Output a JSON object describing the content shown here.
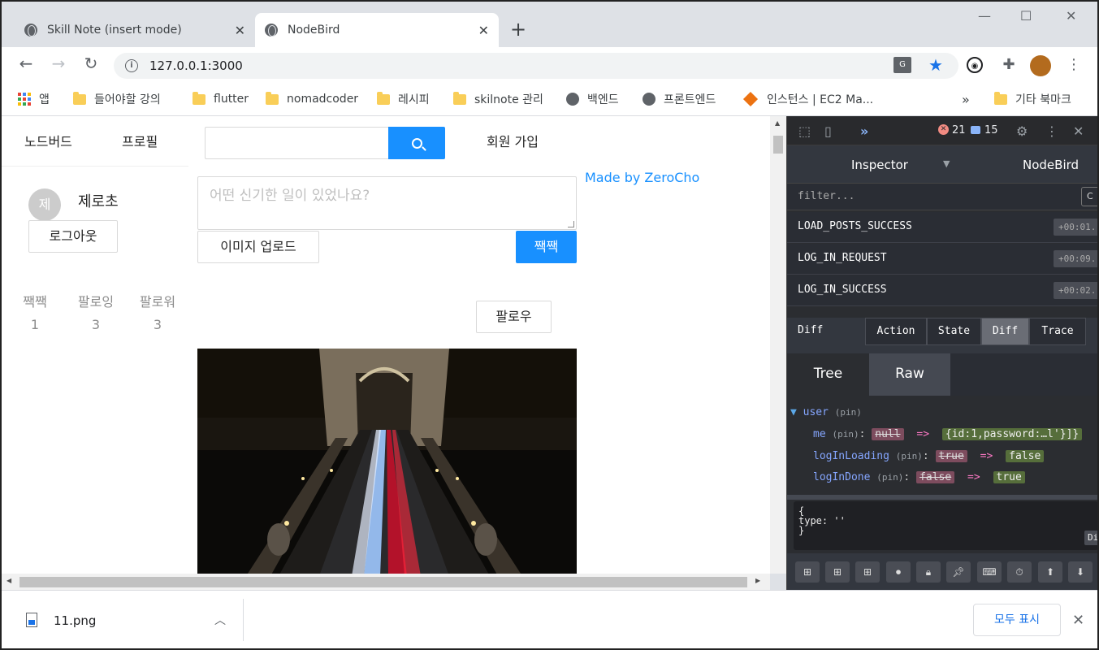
{
  "browser": {
    "tabs": [
      {
        "title": "Skill Note (insert mode)",
        "active": false
      },
      {
        "title": "NodeBird",
        "active": true
      }
    ],
    "new_tab": "+",
    "url": "127.0.0.1:3000",
    "bookmarks": [
      {
        "label": "앱",
        "icon": "apps-grid-icon"
      },
      {
        "label": "들어야할 강의",
        "icon": "folder-icon"
      },
      {
        "label": "flutter",
        "icon": "folder-icon"
      },
      {
        "label": "nomadcoder",
        "icon": "folder-icon"
      },
      {
        "label": "레시피",
        "icon": "folder-icon"
      },
      {
        "label": "skilnote 관리",
        "icon": "folder-icon"
      },
      {
        "label": "백엔드",
        "icon": "globe-icon"
      },
      {
        "label": "프론트엔드",
        "icon": "globe-icon"
      },
      {
        "label": "인스턴스 | EC2 Ma...",
        "icon": "aws-cube-icon"
      }
    ],
    "more_bookmarks": "»",
    "other_bookmarks": "기타 북마크"
  },
  "app": {
    "menu": {
      "home": "노드버드",
      "profile": "프로필",
      "signup": "회원 가입"
    },
    "search": {
      "placeholder": ""
    },
    "user": {
      "avatar_initial": "제",
      "nickname": "제로초",
      "logout": "로그아웃"
    },
    "stats": [
      {
        "label": "짹짹",
        "value": "1"
      },
      {
        "label": "팔로잉",
        "value": "3"
      },
      {
        "label": "팔로워",
        "value": "3"
      }
    ],
    "post_form": {
      "placeholder": "어떤 신기한 일이 있었나요?",
      "image_upload": "이미지 업로드",
      "submit": "짹짹"
    },
    "made_by": "Made by ZeroCho",
    "follow": "팔로우"
  },
  "devtools": {
    "error_count": "21",
    "message_count": "15",
    "panel": "Inspector",
    "store": "NodeBird",
    "filter_placeholder": "filter...",
    "actions": [
      {
        "name": "LOAD_POSTS_SUCCESS",
        "time": "+00:01."
      },
      {
        "name": "LOG_IN_REQUEST",
        "time": "+00:09."
      },
      {
        "name": "LOG_IN_SUCCESS",
        "time": "+00:02."
      }
    ],
    "diff_label": "Diff",
    "tabs": [
      "Action",
      "State",
      "Diff",
      "Trace"
    ],
    "active_tab": "Diff",
    "subtabs": [
      "Tree",
      "Raw"
    ],
    "tree": {
      "root": "user",
      "pin": "(pin)",
      "rows": [
        {
          "key": "me",
          "old": "null",
          "new": "{id:1,password:…l'}]}"
        },
        {
          "key": "logInLoading",
          "old": "true",
          "new": "false"
        },
        {
          "key": "logInDone",
          "old": "false",
          "new": "true"
        }
      ]
    },
    "action_preview": [
      "{",
      "type: ''",
      "}"
    ],
    "action_preview_button": "Di"
  },
  "downloads": {
    "file": "11.png",
    "show_all": "모두 표시"
  },
  "colors": {
    "primary": "#1890ff",
    "devtools_bg": "#2b2d31",
    "diff_old": "#7d4c5e",
    "diff_new": "#566e3b"
  }
}
